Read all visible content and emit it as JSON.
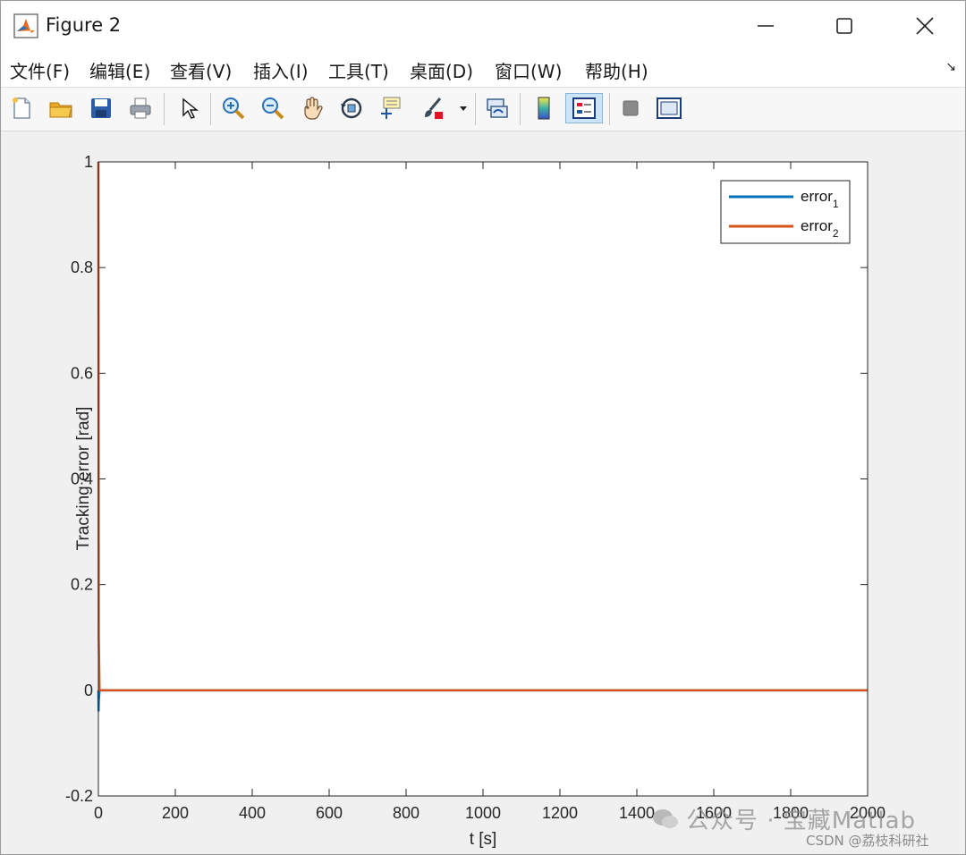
{
  "window": {
    "title": "Figure 2",
    "controls": {
      "minimize": "—",
      "maximize": "☐",
      "close": "✕"
    }
  },
  "menu": {
    "items": [
      "文件(F)",
      "编辑(E)",
      "查看(V)",
      "插入(I)",
      "工具(T)",
      "桌面(D)",
      "窗口(W)",
      "帮助(H)"
    ],
    "overflow_arrow": "↘"
  },
  "toolbar": {
    "buttons": [
      "new-file-icon",
      "open-folder-icon",
      "save-icon",
      "print-icon",
      "pointer-icon",
      "zoom-in-icon",
      "zoom-out-icon",
      "pan-hand-icon",
      "rotate-3d-icon",
      "data-cursor-icon",
      "brush-icon",
      "dropdown-arrow-icon",
      "link-plot-icon",
      "colorbar-icon",
      "legend-icon",
      "hide-plot-tools-icon",
      "show-plot-tools-icon"
    ],
    "pressed": "legend-icon"
  },
  "chart_data": {
    "type": "line",
    "xlabel": "t [s]",
    "ylabel": "Tracking error [rad]",
    "xlim": [
      0,
      2000
    ],
    "ylim": [
      -0.2,
      1
    ],
    "xticks": [
      "0",
      "200",
      "400",
      "600",
      "800",
      "1000",
      "1200",
      "1400",
      "1600",
      "1800",
      "2000"
    ],
    "yticks": [
      "-0.2",
      "0",
      "0.2",
      "0.4",
      "0.6",
      "0.8",
      "1"
    ],
    "legend_position": "top-right",
    "series": [
      {
        "name": "error",
        "subscript": "1",
        "color": "#0072bd",
        "x": [
          0,
          0.5,
          1,
          3,
          2000
        ],
        "y": [
          0,
          -0.04,
          -0.02,
          0,
          0
        ]
      },
      {
        "name": "error",
        "subscript": "2",
        "color": "#d95319",
        "x": [
          0,
          1,
          3,
          2000
        ],
        "y": [
          1,
          0.1,
          0,
          0
        ]
      }
    ]
  },
  "watermark": {
    "account": "公众号 · 宝藏Matlab",
    "source": "CSDN @荔枝科研社"
  }
}
